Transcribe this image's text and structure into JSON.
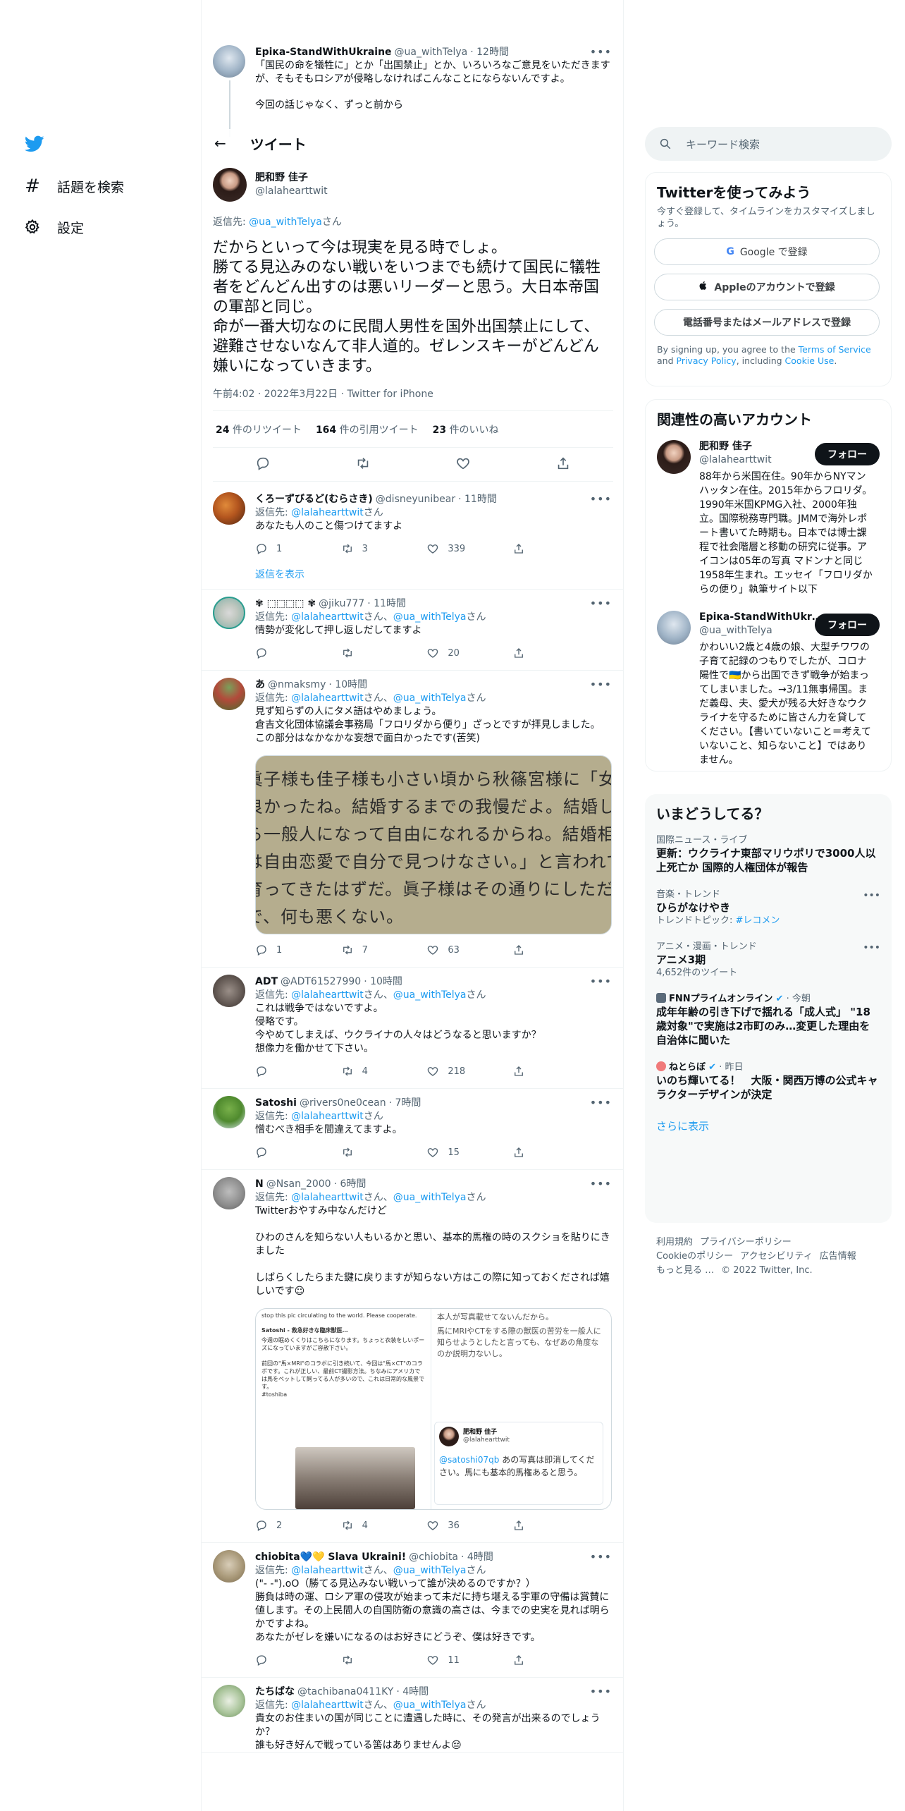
{
  "nav": {
    "explore_label": "話題を検索",
    "settings_label": "設定"
  },
  "prev_tweet": {
    "name": "Ерiка-StandWithUkraine",
    "handle": "@ua_withTelya",
    "time": "· 12時間",
    "text": "「国民の命を犠牲に」とか「出国禁止」とか、いろいろなご意見をいただきますが、そもそもロシアが侵略しなければこんなことにならないんですよ。",
    "text2": "今回の話じゃなく、ずっと前から"
  },
  "header": {
    "back": "←",
    "title": "ツイート"
  },
  "main_tweet": {
    "name": "肥和野 佳子",
    "handle": "@lalahearttwit",
    "reply_prefix": "返信先: ",
    "reply_to": "@ua_withTelya",
    "reply_suffix": "さん",
    "text": "だからといって今は現実を見る時でしょ。\n勝てる見込みのない戦いをいつまでも続けて国民に犠牲者をどんどん出すのは悪いリーダーと思う。大日本帝国の軍部と同じ。\n命が一番大切なのに民間人男性を国外出国禁止にして、避難させないなんて非人道的。ゼレンスキーがどんどん嫌いになっていきます。",
    "timestamp": "午前4:02 · 2022年3月22日 · Twitter for iPhone",
    "retweets": "24",
    "retweets_label": "件のリツイート",
    "quotes": "164",
    "quotes_label": "件の引用ツイート",
    "likes": "23",
    "likes_label": "件のいいね"
  },
  "replies": [
    {
      "name": "くろーずびるど(むらさき)",
      "handle": "@disneyunibear",
      "time": "· 11時間",
      "reply_prefix": "返信先: ",
      "reply_to": "@lalahearttwit",
      "reply_suffix": "さん",
      "text": "あなたも人のこと傷つけてますよ",
      "replies": "1",
      "retweets": "3",
      "likes": "339",
      "show_replies": "返信を表示"
    },
    {
      "name": "✾ ⬚⬚⬚⬚ ✾",
      "handle": "@jiku777",
      "time": "· 11時間",
      "reply_prefix": "返信先: ",
      "reply_to": "@lalahearttwit",
      "reply_mid": "さん、",
      "reply_to2": "@ua_withTelya",
      "reply_suffix": "さん",
      "text": "情勢が変化して押し返しだしてますよ",
      "replies": "",
      "retweets": "",
      "likes": "20"
    },
    {
      "name": "あ",
      "handle": "@nmaksmy",
      "time": "· 10時間",
      "reply_prefix": "返信先: ",
      "reply_to": "@lalahearttwit",
      "reply_mid": "さん、",
      "reply_to2": "@ua_withTelya",
      "reply_suffix": "さん",
      "text": "見ず知らずの人にタメ語はやめましょう。\n倉吉文化団体協議会事務局「フロリダから便り」ざっとですが拝見しました。\nこの部分はなかなかな妄想で面白かったです(苦笑)",
      "image_lines": [
        "眞子様も佳子様も小さい頃から秋篠宮様に「女で",
        "良かったね。結婚するまでの我慢だよ。結婚した",
        "ら一般人になって自由になれるからね。結婚相手",
        "は自由恋愛で自分で見つけなさい。」と言われて",
        "育ってきたはずだ。眞子様はその通りにしただけ",
        "で、何も悪くない。"
      ],
      "replies": "1",
      "retweets": "7",
      "likes": "63"
    },
    {
      "name": "ADT",
      "handle": "@ADT61527990",
      "time": "· 10時間",
      "reply_prefix": "返信先: ",
      "reply_to": "@lalahearttwit",
      "reply_mid": "さん、",
      "reply_to2": "@ua_withTelya",
      "reply_suffix": "さん",
      "text": "これは戦争ではないですよ。\n侵略です。\n今やめてしまえば、ウクライナの人々はどうなると思いますか？\n想像力を働かせて下さい。",
      "replies": "",
      "retweets": "4",
      "likes": "218"
    },
    {
      "name": "Satoshi",
      "handle": "@rivers0ne0cean",
      "time": "· 7時間",
      "reply_prefix": "返信先: ",
      "reply_to": "@lalahearttwit",
      "reply_suffix": "さん",
      "text": "憎むべき相手を間違えてますよ。",
      "replies": "",
      "retweets": "",
      "likes": "15"
    },
    {
      "name": "N",
      "handle": "@Nsan_2000",
      "time": "· 6時間",
      "reply_prefix": "返信先: ",
      "reply_to": "@lalahearttwit",
      "reply_mid": "さん、",
      "reply_to2": "@ua_withTelya",
      "reply_suffix": "さん",
      "text": "Twitterおやすみ中なんだけど\n\nひわのさんを知らない人もいるかと思い、基本的馬権の時のスクショを貼りにきました\n\nしばらくしたらまた鍵に戻りますが知らない方はこの際に知っておくだされば嬉しいです☺",
      "shot": {
        "left_top": "stop this pic circulating to the world. Please cooperate.",
        "left_name": "Satoshi - 救急好きな臨床獣医…",
        "left_body": "今週の眠めくくりはこちらになります。ちょっと衣装をしいポーズになっていますがご容赦下さい。\n\n前回の\"馬×MRI\"のコラボに引き続いて、今回は\"馬×CT\"のコラボです。これが正しい、最前CT撮影方法。ちなみにアメリカでは馬をペットして飼ってる人が多いので、これは日常的な風景です。\n#toshiba",
        "right_top": "本人が写真載せてないんだから。",
        "right_mid": "馬にMRIやCTをする際の獣医の苦労を一般人に知らせようとしたと言っても、なぜあの角度なのか説明力ないし。",
        "inner_name": "肥和野 佳子",
        "inner_handle": "@lalahearttwit",
        "inner_handle_ref": "@satoshi07qb",
        "inner_text": " あの写真は即消してください。馬にも基本的馬権あると思う。"
      },
      "replies": "2",
      "retweets": "4",
      "likes": "36"
    },
    {
      "name": "chiobita💙💛 Slava Ukraini!",
      "handle": "@chiobita",
      "time": "· 4時間",
      "reply_prefix": "返信先: ",
      "reply_to": "@lalahearttwit",
      "reply_mid": "さん、",
      "reply_to2": "@ua_withTelya",
      "reply_suffix": "さん",
      "text": "(\"- -\").oO（勝てる見込みない戦いって誰が決めるのですか？）\n勝負は時の運、ロシア軍の侵攻が始まって未だに持ち堪える宇軍の守備は賞賛に値します。その上民間人の自国防衛の意識の高さは、今までの史実を見れば明らかですよね。\nあなたがゼレを嫌いになるのはお好きにどうぞ、僕は好きです。",
      "replies": "",
      "retweets": "",
      "likes": "11"
    },
    {
      "name": "たちばな",
      "handle": "@tachibana0411KY",
      "time": "· 4時間",
      "reply_prefix": "返信先: ",
      "reply_to": "@lalahearttwit",
      "reply_mid": "さん、",
      "reply_to2": "@ua_withTelya",
      "reply_suffix": "さん",
      "text": "貴女のお住まいの国が同じことに遭遇した時に、その発言が出来るのでしょうか？\n誰も好き好んで戦っている筈はありませんよ😔"
    }
  ],
  "search": {
    "placeholder": "キーワード検索"
  },
  "signup": {
    "title": "Twitterを使ってみよう",
    "subtitle": "今すぐ登録して、タイムラインをカスタマイズしましょう。",
    "google": "Google で登録",
    "apple": "Appleのアカウントで登録",
    "phone": "電話番号またはメールアドレスで登録",
    "legal_1": "By signing up, you agree to the ",
    "terms": "Terms of Service",
    "legal_2": " and ",
    "privacy": "Privacy Policy",
    "legal_3": ", including ",
    "cookie": "Cookie Use",
    "legal_4": "."
  },
  "related": {
    "title": "関連性の高いアカウント",
    "follow_label": "フォロー",
    "accounts": [
      {
        "name": "肥和野 佳子",
        "handle": "@lalahearttwit",
        "bio": "88年から米国在住。90年からNYマンハッタン在住。2015年からフロリダ。1990年米国KPMG入社、2000年独立。国際税務専門職。JMMで海外レポート書いてた時期も。日本では博士課程で社会階層と移動の研究に従事。アイコンは05年の写真 マドンナと同じ1958年生まれ。エッセイ「フロリダからの便り」執筆サイト以下"
      },
      {
        "name": "Ерiка-StandWithUkr…",
        "handle": "@ua_withTelya",
        "bio": "かわいい2歳と4歳の娘、大型チワワの子育て記録のつもりでしたが、コロナ陽性で🇺🇦から出国できず戦争が始まってしまいました。→3/11無事帰国。まだ義母、夫、愛犬が残る大好きなウクライナを守るために皆さん力を貸してください。【書いていないこと＝考えていないこと、知らないこと】ではありません。"
      }
    ]
  },
  "trends": {
    "title": "いまどうしてる？",
    "items": [
      {
        "ctx": "国際ニュース・ライブ",
        "title": "更新：ウクライナ東部マリウポリで3000人以上死亡か 国際的人権団体が報告",
        "sub": ""
      },
      {
        "ctx": "音楽・トレンド",
        "title": "ひらがなけやき",
        "sub_prefix": "トレンドトピック: ",
        "sub_link": "#レコメン"
      },
      {
        "ctx": "アニメ・漫画・トレンド",
        "title": "アニメ3期",
        "sub": "4,652件のツイート"
      },
      {
        "ctx_name": "FNNプライムオンライン",
        "ctx_time": "· 今朝",
        "title": "成年年齢の引き下げで揺れる「成人式」 \"18歳対象\"で実施は2市町のみ…変更した理由を自治体に聞いた"
      },
      {
        "ctx_name": "ねとらぼ",
        "ctx_time": "· 昨日",
        "title": "いのち輝いてる！　大阪・関西万博の公式キャラクターデザインが決定"
      }
    ],
    "show_more": "さらに表示"
  },
  "footer": {
    "terms": "利用規約",
    "privacy": "プライバシーポリシー",
    "cookie": "Cookieのポリシー",
    "a11y": "アクセシビリティ",
    "ads": "広告情報",
    "more": "もっと見る …",
    "copy": "© 2022 Twitter, Inc."
  }
}
